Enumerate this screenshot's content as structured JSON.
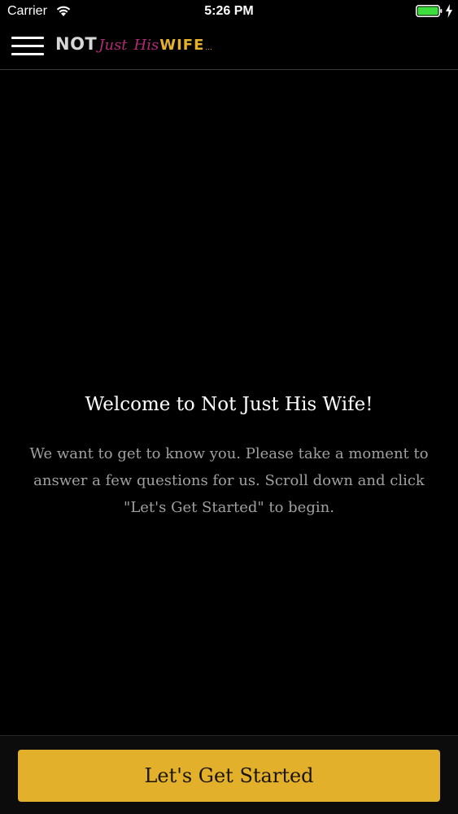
{
  "status_bar": {
    "carrier": "Carrier",
    "time": "5:26 PM",
    "battery_color": "#3ddc3d"
  },
  "nav": {
    "menu_icon": "hamburger-menu-icon",
    "logo": {
      "part1": "NOT",
      "part2": "Just",
      "part3": "His",
      "part4": "WIFE",
      "part5": "..."
    },
    "colors": {
      "not": "#d7d7d7",
      "script": "#b32b74",
      "wife": "#e3b12b"
    }
  },
  "content": {
    "title": "Welcome to Not Just His Wife!",
    "body": "We want to get to know you. Please take a moment to answer a few questions for us. Scroll down and click \"Let's Get Started\" to begin."
  },
  "footer": {
    "button_label": "Let's Get Started",
    "button_color": "#e2b02a"
  }
}
